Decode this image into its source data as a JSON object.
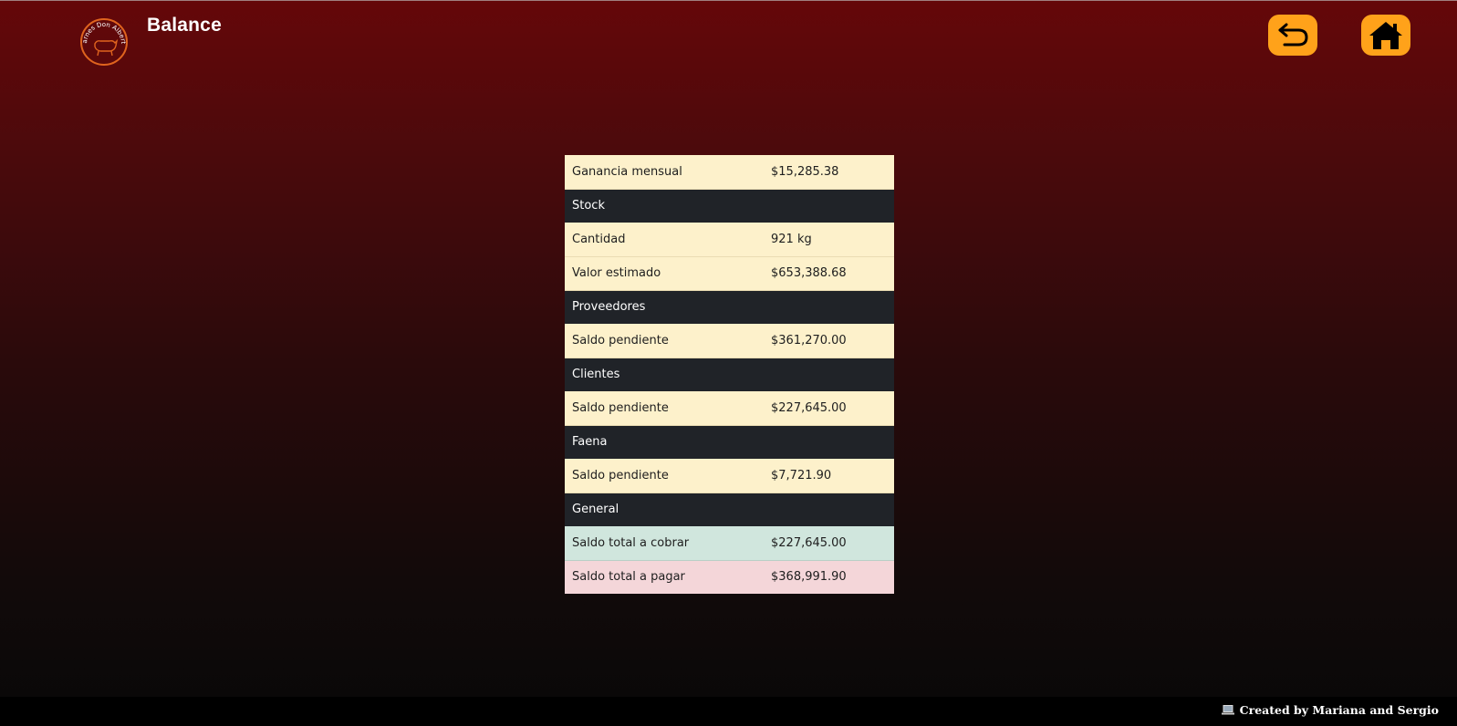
{
  "header": {
    "title": "Balance",
    "logo_text": "Carnes Don Alberto",
    "back_icon": "back-arrow-icon",
    "home_icon": "home-icon",
    "accent_color": "#ffa21a"
  },
  "table": {
    "ganancia": {
      "label": "Ganancia mensual",
      "value": "$15,285.38"
    },
    "stock": {
      "heading": "Stock",
      "cantidad": {
        "label": "Cantidad",
        "value": "921 kg"
      },
      "valor": {
        "label": "Valor estimado",
        "value": "$653,388.68"
      }
    },
    "proveedores": {
      "heading": "Proveedores",
      "saldo": {
        "label": "Saldo pendiente",
        "value": "$361,270.00"
      }
    },
    "clientes": {
      "heading": "Clientes",
      "saldo": {
        "label": "Saldo pendiente",
        "value": "$227,645.00"
      }
    },
    "faena": {
      "heading": "Faena",
      "saldo": {
        "label": "Saldo pendiente",
        "value": "$7,721.90"
      }
    },
    "general": {
      "heading": "General",
      "cobrar": {
        "label": "Saldo total a cobrar",
        "value": "$227,645.00"
      },
      "pagar": {
        "label": "Saldo total a pagar",
        "value": "$368,991.90"
      }
    }
  },
  "footer": {
    "icon": "laptop-icon",
    "text": "Created by Mariana and Sergio"
  }
}
